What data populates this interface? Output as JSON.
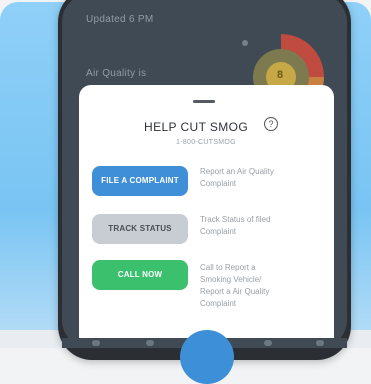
{
  "background_screen": {
    "line1": "Updated 6 PM",
    "line2": "Air Quality is",
    "gauge_value": "8"
  },
  "sheet": {
    "title": "HELP CUT SMOG",
    "subtitle": "1-800-CUTSMOG",
    "help_icon": "?",
    "actions": [
      {
        "button": "FILE A COMPLAINT",
        "description": "Report an Air Quality Complaint"
      },
      {
        "button": "TRACK STATUS",
        "description": "Track Status of filed Complaint"
      },
      {
        "button": "CALL NOW",
        "description": "Call to Report a Smoking Vehicle/ Report a Air Quality Complaint"
      }
    ]
  },
  "colors": {
    "file": "#3f8fd8",
    "track": "#c8ccd3",
    "call": "#3bc06e",
    "background": "#8fd0f8"
  }
}
